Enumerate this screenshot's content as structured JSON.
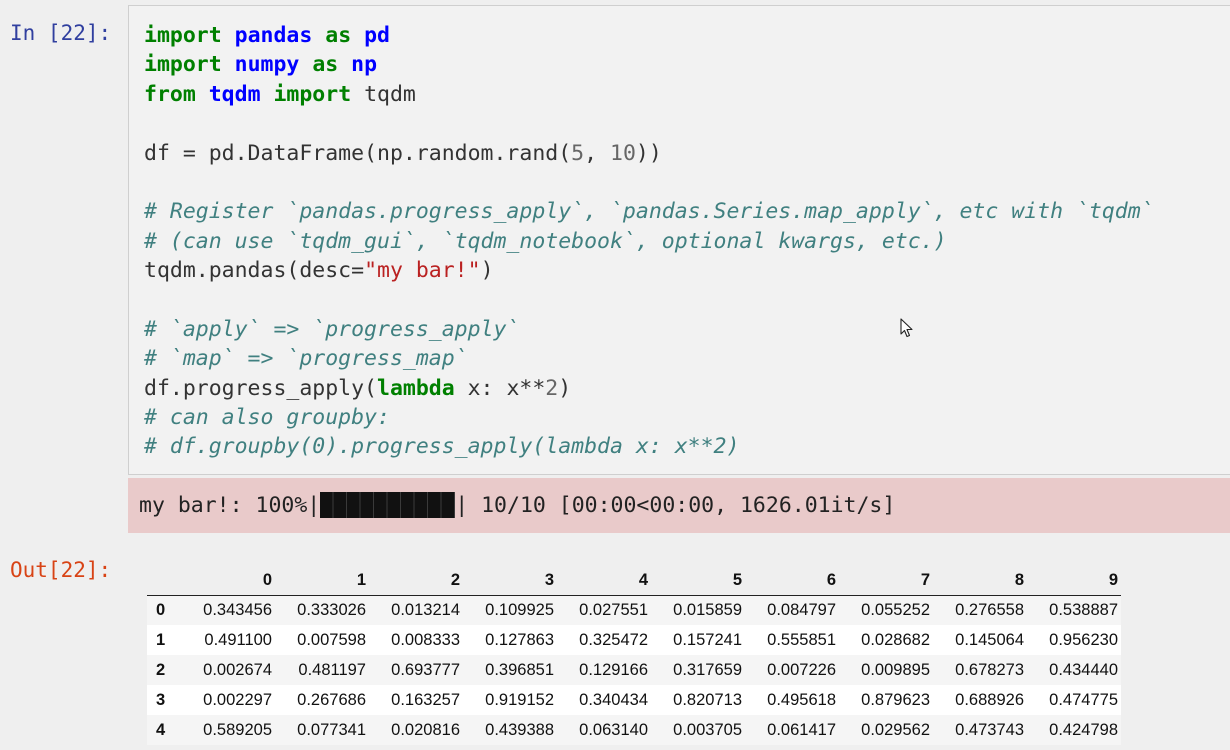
{
  "cell": {
    "in_prompt": "In [22]:",
    "out_prompt": "Out[22]:"
  },
  "code": [
    [
      {
        "t": "kw",
        "v": "import"
      },
      {
        "t": "n",
        "v": " "
      },
      {
        "t": "nn",
        "v": "pandas"
      },
      {
        "t": "n",
        "v": " "
      },
      {
        "t": "kw",
        "v": "as"
      },
      {
        "t": "n",
        "v": " "
      },
      {
        "t": "nn",
        "v": "pd"
      }
    ],
    [
      {
        "t": "kw",
        "v": "import"
      },
      {
        "t": "n",
        "v": " "
      },
      {
        "t": "nn",
        "v": "numpy"
      },
      {
        "t": "n",
        "v": " "
      },
      {
        "t": "kw",
        "v": "as"
      },
      {
        "t": "n",
        "v": " "
      },
      {
        "t": "nn",
        "v": "np"
      }
    ],
    [
      {
        "t": "kw",
        "v": "from"
      },
      {
        "t": "n",
        "v": " "
      },
      {
        "t": "nn",
        "v": "tqdm"
      },
      {
        "t": "n",
        "v": " "
      },
      {
        "t": "kw",
        "v": "import"
      },
      {
        "t": "n",
        "v": " tqdm"
      }
    ],
    [],
    [
      {
        "t": "n",
        "v": "df = pd.DataFrame(np.random.rand("
      },
      {
        "t": "num",
        "v": "5"
      },
      {
        "t": "n",
        "v": ", "
      },
      {
        "t": "num",
        "v": "10"
      },
      {
        "t": "n",
        "v": "))"
      }
    ],
    [],
    [
      {
        "t": "c",
        "v": "# Register `pandas.progress_apply`, `pandas.Series.map_apply`, etc with `tqdm`"
      }
    ],
    [
      {
        "t": "c",
        "v": "# (can use `tqdm_gui`, `tqdm_notebook`, optional kwargs, etc.)"
      }
    ],
    [
      {
        "t": "n",
        "v": "tqdm.pandas(desc="
      },
      {
        "t": "s",
        "v": "\"my bar!\""
      },
      {
        "t": "n",
        "v": ")"
      }
    ],
    [],
    [
      {
        "t": "c",
        "v": "# `apply` => `progress_apply`"
      }
    ],
    [
      {
        "t": "c",
        "v": "# `map` => `progress_map`"
      }
    ],
    [
      {
        "t": "n",
        "v": "df.progress_apply("
      },
      {
        "t": "kw",
        "v": "lambda"
      },
      {
        "t": "n",
        "v": " x: x"
      },
      {
        "t": "n",
        "v": "**"
      },
      {
        "t": "num",
        "v": "2"
      },
      {
        "t": "n",
        "v": ")"
      }
    ],
    [
      {
        "t": "c",
        "v": "# can also groupby:"
      }
    ],
    [
      {
        "t": "c",
        "v": "# df.groupby(0).progress_apply(lambda x: x**2)"
      }
    ]
  ],
  "stderr": {
    "prefix": "my bar!: 100%|",
    "suffix": "| 10/10 [00:00<00:00, 1626.01it/s]",
    "progress": 1.0
  },
  "dataframe": {
    "columns": [
      "0",
      "1",
      "2",
      "3",
      "4",
      "5",
      "6",
      "7",
      "8",
      "9"
    ],
    "index": [
      "0",
      "1",
      "2",
      "3",
      "4"
    ],
    "rows": [
      [
        "0.343456",
        "0.333026",
        "0.013214",
        "0.109925",
        "0.027551",
        "0.015859",
        "0.084797",
        "0.055252",
        "0.276558",
        "0.538887"
      ],
      [
        "0.491100",
        "0.007598",
        "0.008333",
        "0.127863",
        "0.325472",
        "0.157241",
        "0.555851",
        "0.028682",
        "0.145064",
        "0.956230"
      ],
      [
        "0.002674",
        "0.481197",
        "0.693777",
        "0.396851",
        "0.129166",
        "0.317659",
        "0.007226",
        "0.009895",
        "0.678273",
        "0.434440"
      ],
      [
        "0.002297",
        "0.267686",
        "0.163257",
        "0.919152",
        "0.340434",
        "0.820713",
        "0.495618",
        "0.879623",
        "0.688926",
        "0.474775"
      ],
      [
        "0.589205",
        "0.077341",
        "0.020816",
        "0.439388",
        "0.063140",
        "0.003705",
        "0.061417",
        "0.029562",
        "0.473743",
        "0.424798"
      ]
    ]
  },
  "icons": {
    "cursor": "mouse-pointer-icon"
  },
  "colors": {
    "in_prompt": "#303f9f",
    "out_prompt": "#d84315",
    "stderr_bg": "#e9caca",
    "keyword": "#008000",
    "module": "#0000ff",
    "comment": "#408080",
    "string": "#ba2121"
  }
}
